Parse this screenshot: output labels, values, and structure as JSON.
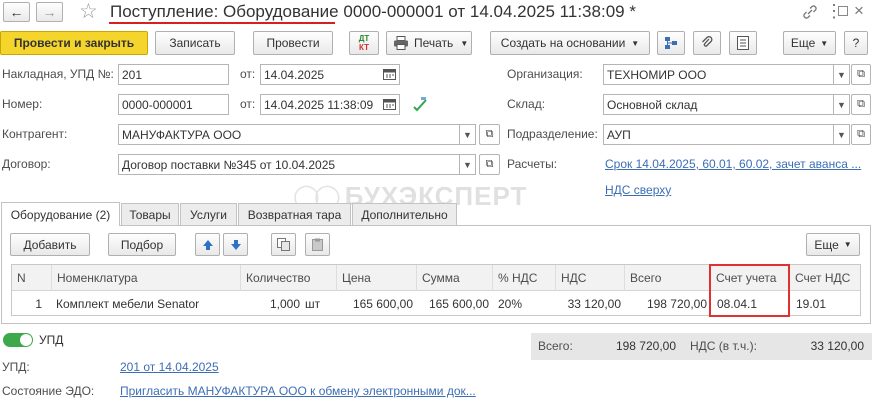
{
  "window": {
    "title": "Поступление: Оборудование 0000-000001 от 14.04.2025 11:38:09 *"
  },
  "toolbar": {
    "post_close": "Провести и закрыть",
    "save": "Записать",
    "post": "Провести",
    "dtkt_1": "ДТ",
    "dtkt_2": "КТ",
    "print": "Печать",
    "create_based": "Создать на основании",
    "more": "Еще",
    "help": "?"
  },
  "form": {
    "invoice_label": "Накладная, УПД №:",
    "invoice_value": "201",
    "from_label_1": "от:",
    "invoice_date": "14.04.2025",
    "number_label": "Номер:",
    "number_value": "0000-000001",
    "from_label_2": "от:",
    "number_date": "14.04.2025 11:38:09",
    "counterparty_label": "Контрагент:",
    "counterparty_value": "МАНУФАКТУРА ООО",
    "contract_label": "Договор:",
    "contract_value": "Договор поставки №345 от 10.04.2025",
    "org_label": "Организация:",
    "org_value": "ТЕХНОМИР ООО",
    "warehouse_label": "Склад:",
    "warehouse_value": "Основной склад",
    "division_label": "Подразделение:",
    "division_value": "АУП",
    "settlements_label": "Расчеты:",
    "settlements_link": "Срок 14.04.2025, 60.01, 60.02, зачет аванса ...",
    "vat_link": "НДС сверху"
  },
  "watermark": "БУХЭКСПЕРТ",
  "tabs": [
    {
      "label": "Оборудование (2)"
    },
    {
      "label": "Товары"
    },
    {
      "label": "Услуги"
    },
    {
      "label": "Возвратная тара"
    },
    {
      "label": "Дополнительно"
    }
  ],
  "table_toolbar": {
    "add": "Добавить",
    "select": "Подбор",
    "more": "Еще"
  },
  "table": {
    "columns": [
      "N",
      "Номенклатура",
      "Количество",
      "Цена",
      "Сумма",
      "% НДС",
      "НДС",
      "Всего",
      "Счет учета",
      "Счет НДС"
    ],
    "rows": [
      {
        "n": "1",
        "name": "Комплект мебели Senator",
        "qty": "1,000",
        "unit": "шт",
        "price": "165 600,00",
        "sum": "165 600,00",
        "vat_rate": "20%",
        "vat": "33 120,00",
        "total": "198 720,00",
        "account": "08.04.1",
        "vat_account": "19.01"
      }
    ]
  },
  "footer": {
    "upd_toggle": "УПД",
    "upd_label": "УПД:",
    "upd_link": "201 от 14.04.2025",
    "edo_label": "Состояние ЭДО:",
    "edo_link": "Пригласить МАНУФАКТУРА ООО к обмену электронными док...",
    "total_label": "Всего:",
    "total_value": "198 720,00",
    "vat_incl_label": "НДС (в т.ч.):",
    "vat_incl_value": "33 120,00"
  },
  "colors": {
    "primary_button": "#f5d52c",
    "link": "#3c6eb4",
    "highlight_box": "#e03030",
    "title_underline": "#d62020",
    "toggle_on": "#3caa4a"
  }
}
